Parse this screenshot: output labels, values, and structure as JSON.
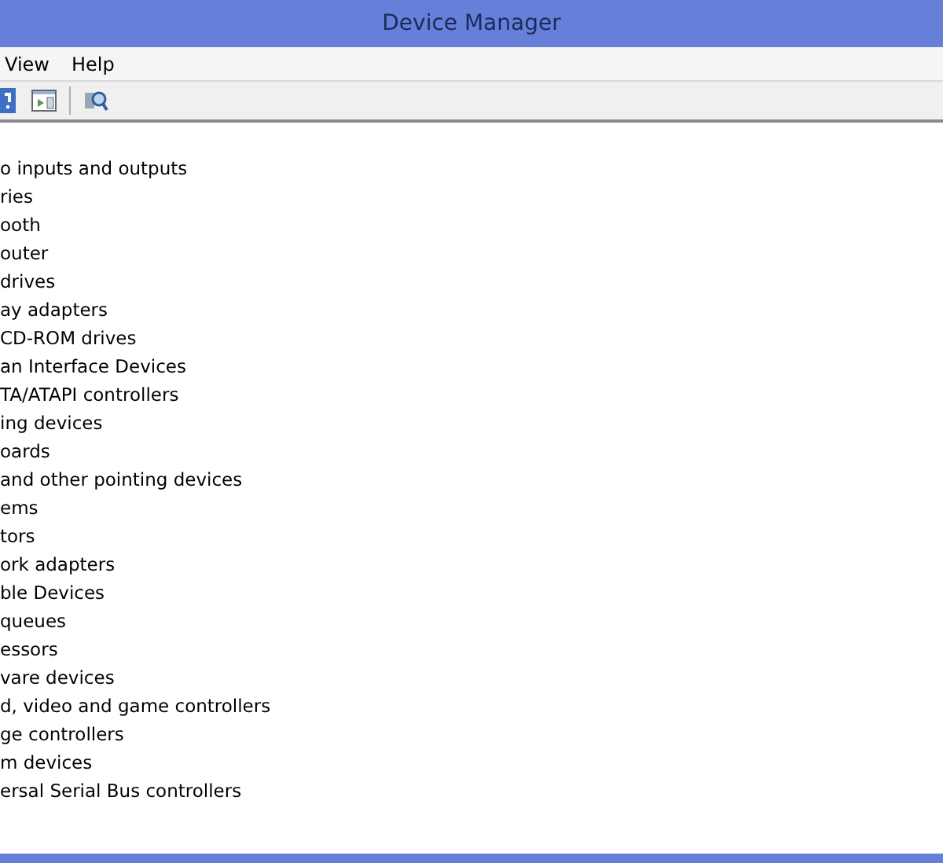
{
  "window": {
    "title": "Device Manager"
  },
  "menu": [
    "View",
    "Help"
  ],
  "tree": {
    "items": [
      "o inputs and outputs",
      "ries",
      "ooth",
      "outer",
      "drives",
      "ay adapters",
      "CD-ROM drives",
      "an Interface Devices",
      "TA/ATAPI controllers",
      "ing devices",
      "oards",
      "and other pointing devices",
      "ems",
      "tors",
      "ork adapters",
      "ble Devices",
      "queues",
      "essors",
      "vare devices",
      "d, video and game controllers",
      "ge controllers",
      "m devices",
      "ersal Serial Bus controllers"
    ]
  }
}
